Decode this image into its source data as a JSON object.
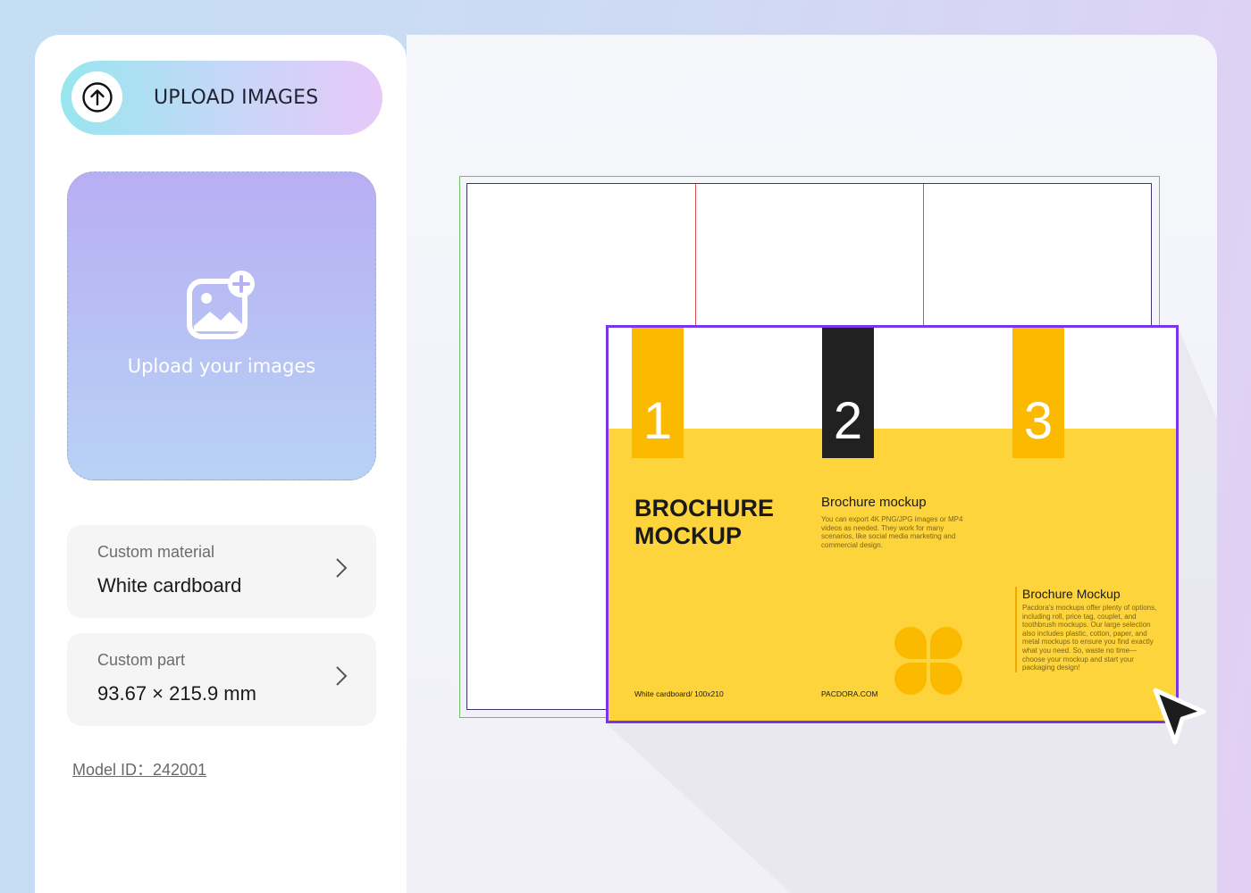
{
  "sidebar": {
    "upload_button_label": "UPLOAD IMAGES",
    "dropzone_text": "Upload your images",
    "material": {
      "label": "Custom material",
      "value": "White cardboard"
    },
    "part": {
      "label": "Custom part",
      "value": "93.67 × 215.9 mm"
    },
    "model_id": "Model ID：242001"
  },
  "brochure": {
    "tabs": [
      {
        "number": "1",
        "color": "#fbb900"
      },
      {
        "number": "2",
        "color": "#212121"
      },
      {
        "number": "3",
        "color": "#fbb900"
      }
    ],
    "title": "BROCHURE MOCKUP",
    "subtitle": "Brochure mockup",
    "description": "You can export 4K PNG/JPG images or MP4 videos as needed. They work for many scenarios, like social media marketing and commercial design.",
    "side_title": "Brochure Mockup",
    "side_description": "Pacdora's mockups offer plenty of options, including roll, price tag, couplet, and toothbrush mockups. Our large selection also includes plastic, cotton, paper, and metal mockups to ensure you find exactly what you need. So, waste no time—choose your mockup and start your packaging design!",
    "footer_left": "White cardboard/ 100x210",
    "footer_mid": "PACDORA.COM"
  },
  "colors": {
    "brochure_yellow": "#fed43d",
    "selection_border": "#7a35e8",
    "fold_line": "#d8514f",
    "bleed_line": "#6fbf63"
  },
  "icons": {
    "upload": "arrow-up-circle-icon",
    "add_image": "image-plus-icon",
    "chevron": "chevron-right-icon",
    "cursor": "mouse-pointer-icon"
  }
}
